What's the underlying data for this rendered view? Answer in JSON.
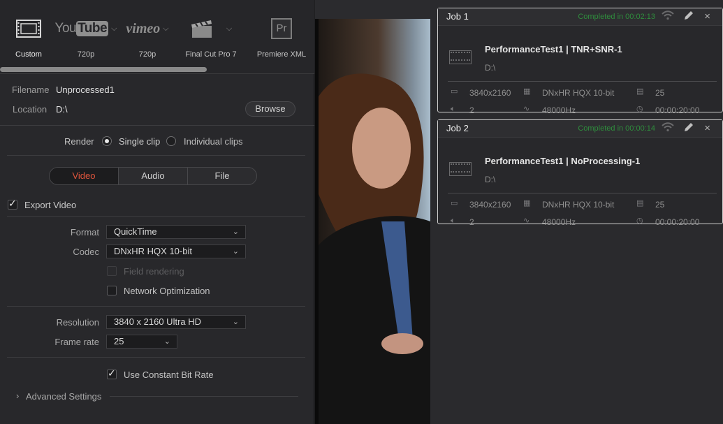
{
  "presets": [
    {
      "id": "custom",
      "label": "Custom",
      "icon": "film-strip-icon",
      "selected": true
    },
    {
      "id": "youtube",
      "label": "720p",
      "icon_text_a": "You",
      "icon_text_b": "Tube",
      "icon": "youtube-logo"
    },
    {
      "id": "vimeo",
      "label": "720p",
      "icon_text": "vimeo",
      "icon": "vimeo-logo"
    },
    {
      "id": "fcp",
      "label": "Final Cut Pro 7",
      "icon": "clapperboard-icon"
    },
    {
      "id": "premiere",
      "label": "Premiere XML",
      "icon_text": "Pr",
      "icon": "premiere-logo"
    }
  ],
  "file": {
    "filename_label": "Filename",
    "filename_value": "Unprocessed1",
    "location_label": "Location",
    "location_value": "D:\\",
    "browse_label": "Browse"
  },
  "render": {
    "label": "Render",
    "single_clip": "Single clip",
    "individual_clips": "Individual clips",
    "selected": "single_clip"
  },
  "tabs": [
    {
      "label": "Video",
      "active": true
    },
    {
      "label": "Audio",
      "active": false
    },
    {
      "label": "File",
      "active": false
    }
  ],
  "video": {
    "export_video_label": "Export Video",
    "export_video_checked": true,
    "format_label": "Format",
    "format_value": "QuickTime",
    "codec_label": "Codec",
    "codec_value": "DNxHR HQX 10-bit",
    "field_rendering_label": "Field rendering",
    "network_opt_label": "Network Optimization",
    "resolution_label": "Resolution",
    "resolution_value": "3840 x 2160 Ultra HD",
    "frame_rate_label": "Frame rate",
    "frame_rate_value": "25",
    "cbr_label": "Use Constant Bit Rate",
    "cbr_checked": true,
    "advanced_label": "Advanced Settings"
  },
  "jobs": [
    {
      "title": "Job 1",
      "status": "Completed in 00:02:13",
      "name": "PerformanceTest1 | TNR+SNR-1",
      "location": "D:\\",
      "resolution": "3840x2160",
      "codec": "DNxHR HQX 10-bit",
      "fps": "25",
      "audio_channels": "2",
      "sample_rate": "48000Hz",
      "duration": "00:00:20:00"
    },
    {
      "title": "Job 2",
      "status": "Completed in 00:00:14",
      "name": "PerformanceTest1 | NoProcessing-1",
      "location": "D:\\",
      "resolution": "3840x2160",
      "codec": "DNxHR HQX 10-bit",
      "fps": "25",
      "audio_channels": "2",
      "sample_rate": "48000Hz",
      "duration": "00:00:20:00"
    }
  ],
  "colors": {
    "accent_tab": "#e0553c",
    "status_green": "#2f8d3d",
    "panel_bg": "#28282b"
  }
}
